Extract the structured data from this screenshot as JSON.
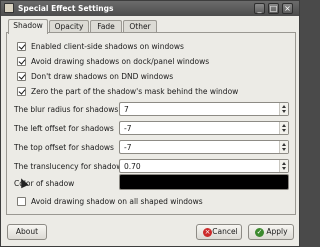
{
  "window": {
    "title": "Special Effect Settings"
  },
  "titlebar_buttons": {
    "minimize": "_",
    "maximize": "□",
    "close": "×"
  },
  "tabs": [
    {
      "label": "Shadow",
      "active": true
    },
    {
      "label": "Opacity",
      "active": false
    },
    {
      "label": "Fade",
      "active": false
    },
    {
      "label": "Other",
      "active": false
    }
  ],
  "shadow": {
    "checkboxes": [
      {
        "label": "Enabled client-side shadows on windows",
        "checked": true
      },
      {
        "label": "Avoid drawing shadows on dock/panel windows",
        "checked": true
      },
      {
        "label": "Don't draw shadows on DND windows",
        "checked": true
      },
      {
        "label": "Zero the part of the shadow's mask behind the window",
        "checked": true
      }
    ],
    "fields": [
      {
        "label": "The blur radius for shadows",
        "value": "7"
      },
      {
        "label": "The left offset for shadows",
        "value": "-7"
      },
      {
        "label": "The top offset for shadows",
        "value": "-7"
      },
      {
        "label": "The translucency for shadows",
        "value": "0.70"
      }
    ],
    "color_label": "Color of shadow",
    "color_value": "#000000",
    "avoid_shaped": {
      "label": "Avoid drawing shadow on all shaped windows",
      "checked": false
    }
  },
  "buttons": {
    "about": "About",
    "cancel": "Cancel",
    "apply": "Apply"
  },
  "icons": {
    "cancel": "cancel-icon",
    "apply": "check-icon",
    "window": "app-icon"
  },
  "colors": {
    "titlebar": "#555555",
    "cancel_icon": "#cc2a2a",
    "apply_icon": "#3c8a2e"
  }
}
